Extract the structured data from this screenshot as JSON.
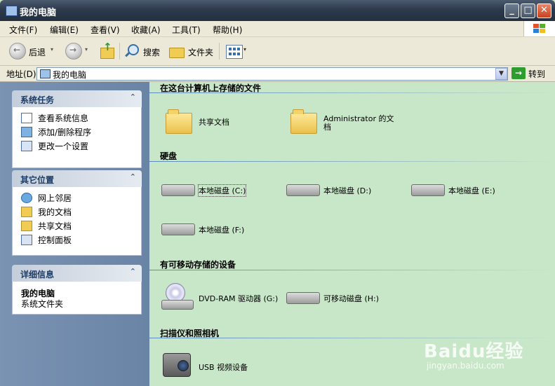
{
  "window": {
    "title": "我的电脑",
    "min": "_",
    "max": "□",
    "close": "✕"
  },
  "menubar": {
    "items": [
      "文件(F)",
      "编辑(E)",
      "查看(V)",
      "收藏(A)",
      "工具(T)",
      "帮助(H)"
    ]
  },
  "toolbar": {
    "back": "后退",
    "search": "搜索",
    "folders": "文件夹"
  },
  "address": {
    "label": "地址(D)",
    "value": "我的电脑",
    "go": "转到"
  },
  "left": {
    "system_tasks": {
      "title": "系统任务",
      "items": [
        "查看系统信息",
        "添加/删除程序",
        "更改一个设置"
      ]
    },
    "other_places": {
      "title": "其它位置",
      "items": [
        "网上邻居",
        "我的文档",
        "共享文档",
        "控制面板"
      ]
    },
    "details": {
      "title": "详细信息",
      "name": "我的电脑",
      "desc": "系统文件夹"
    }
  },
  "sections": {
    "files": {
      "title": "在这台计算机上存储的文件",
      "items": [
        "共享文档",
        "Administrator 的文",
        "档"
      ]
    },
    "hdd": {
      "title": "硬盘",
      "items": [
        "本地磁盘 (C:)",
        "本地磁盘 (D:)",
        "本地磁盘 (E:)",
        "本地磁盘 (F:)"
      ]
    },
    "removable": {
      "title": "有可移动存储的设备",
      "items": [
        "DVD-RAM 驱动器 (G:)",
        "可移动磁盘 (H:)"
      ]
    },
    "scanners": {
      "title": "扫描仪和照相机",
      "items": [
        "USB 视频设备"
      ]
    }
  },
  "watermark": {
    "text": "Baidu经验",
    "sub": "jingyan.baidu.com"
  },
  "colors": {
    "content_bg": "#c8e6c8",
    "left_pane": "#7a93b3",
    "accent": "#2f9c2f"
  }
}
